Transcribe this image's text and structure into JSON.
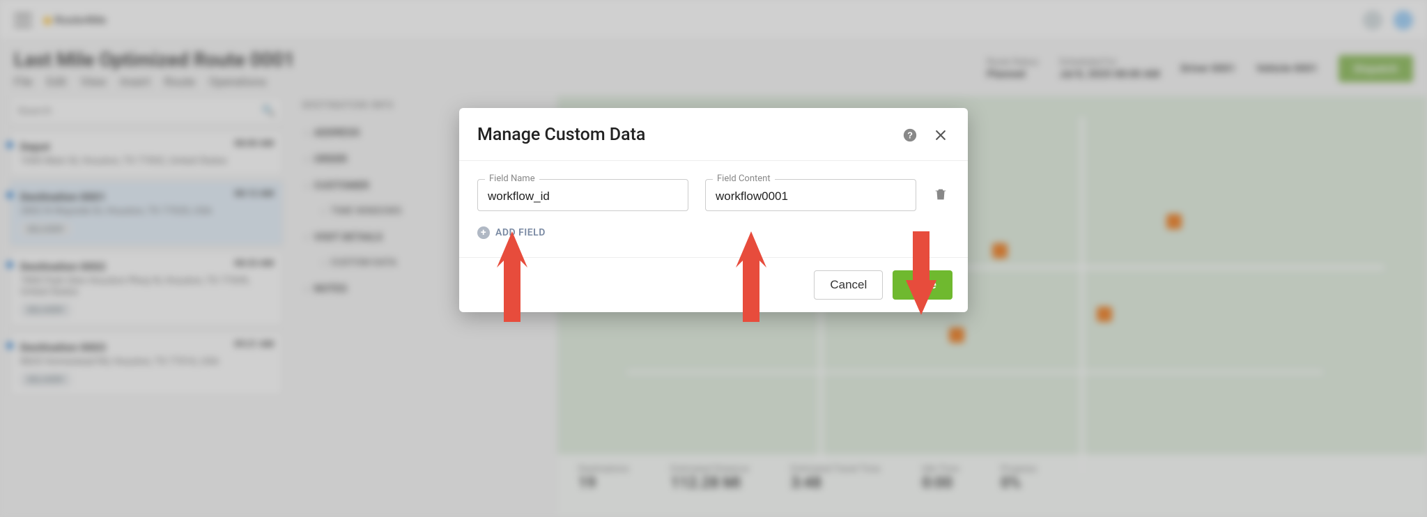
{
  "app": {
    "logo_text": "Route4Me"
  },
  "page": {
    "title": "Last Mile Optimized Route 0001",
    "menus": [
      "File",
      "Edit",
      "View",
      "Insert",
      "Route",
      "Operations"
    ]
  },
  "header": {
    "status_label": "Route Status",
    "status_value": "Planned",
    "sched_label": "Scheduled For",
    "sched_value": "Jul 8, 2025 08:00 AM",
    "driver_label": "Driver 0001",
    "vehicle_label": "Vehicle 0001",
    "dispatch_label": "Dispatch"
  },
  "search": {
    "placeholder": "Search"
  },
  "stops": [
    {
      "name": "Depot",
      "addr": "1000 Main St, Houston, TX 77002, United States",
      "time": "08:00 AM",
      "badge": ""
    },
    {
      "name": "Destination 0001",
      "addr": "2802 N Wayside Dr, Houston, TX 77020, USA",
      "time": "08:12 AM",
      "badge": "DELIVERY"
    },
    {
      "name": "Destination 0002",
      "addr": "7800 Park Glen Houston Pkwy N, Houston, TX 77049, United States",
      "time": "08:33 AM",
      "badge": "DELIVERY"
    },
    {
      "name": "Destination 0003",
      "addr": "8820 Homestead Rd, Houston, TX 77016, USA",
      "time": "09:21 AM",
      "badge": "DELIVERY"
    }
  ],
  "info": {
    "header": "DESTINATION INFO",
    "sections": [
      "ADDRESS",
      "ORDER",
      "CUSTOMER",
      "TIME WINDOWS",
      "VISIT DETAILS",
      "CUSTOM DATA",
      "NOTES"
    ]
  },
  "mapstats": [
    {
      "label": "Destinations",
      "value": "19"
    },
    {
      "label": "Estimated Distance",
      "value": "112.28 MI"
    },
    {
      "label": "Estimated Travel Time",
      "value": "3:48"
    },
    {
      "label": "Idle Time",
      "value": "0:00"
    },
    {
      "label": "Progress",
      "value": "0%"
    }
  ],
  "modal": {
    "title": "Manage Custom Data",
    "field_name_label": "Field Name",
    "field_name_value": "workflow_id",
    "field_content_label": "Field Content",
    "field_content_value": "workflow0001",
    "add_field_label": "ADD FIELD",
    "cancel_label": "Cancel",
    "save_label": "Save"
  }
}
